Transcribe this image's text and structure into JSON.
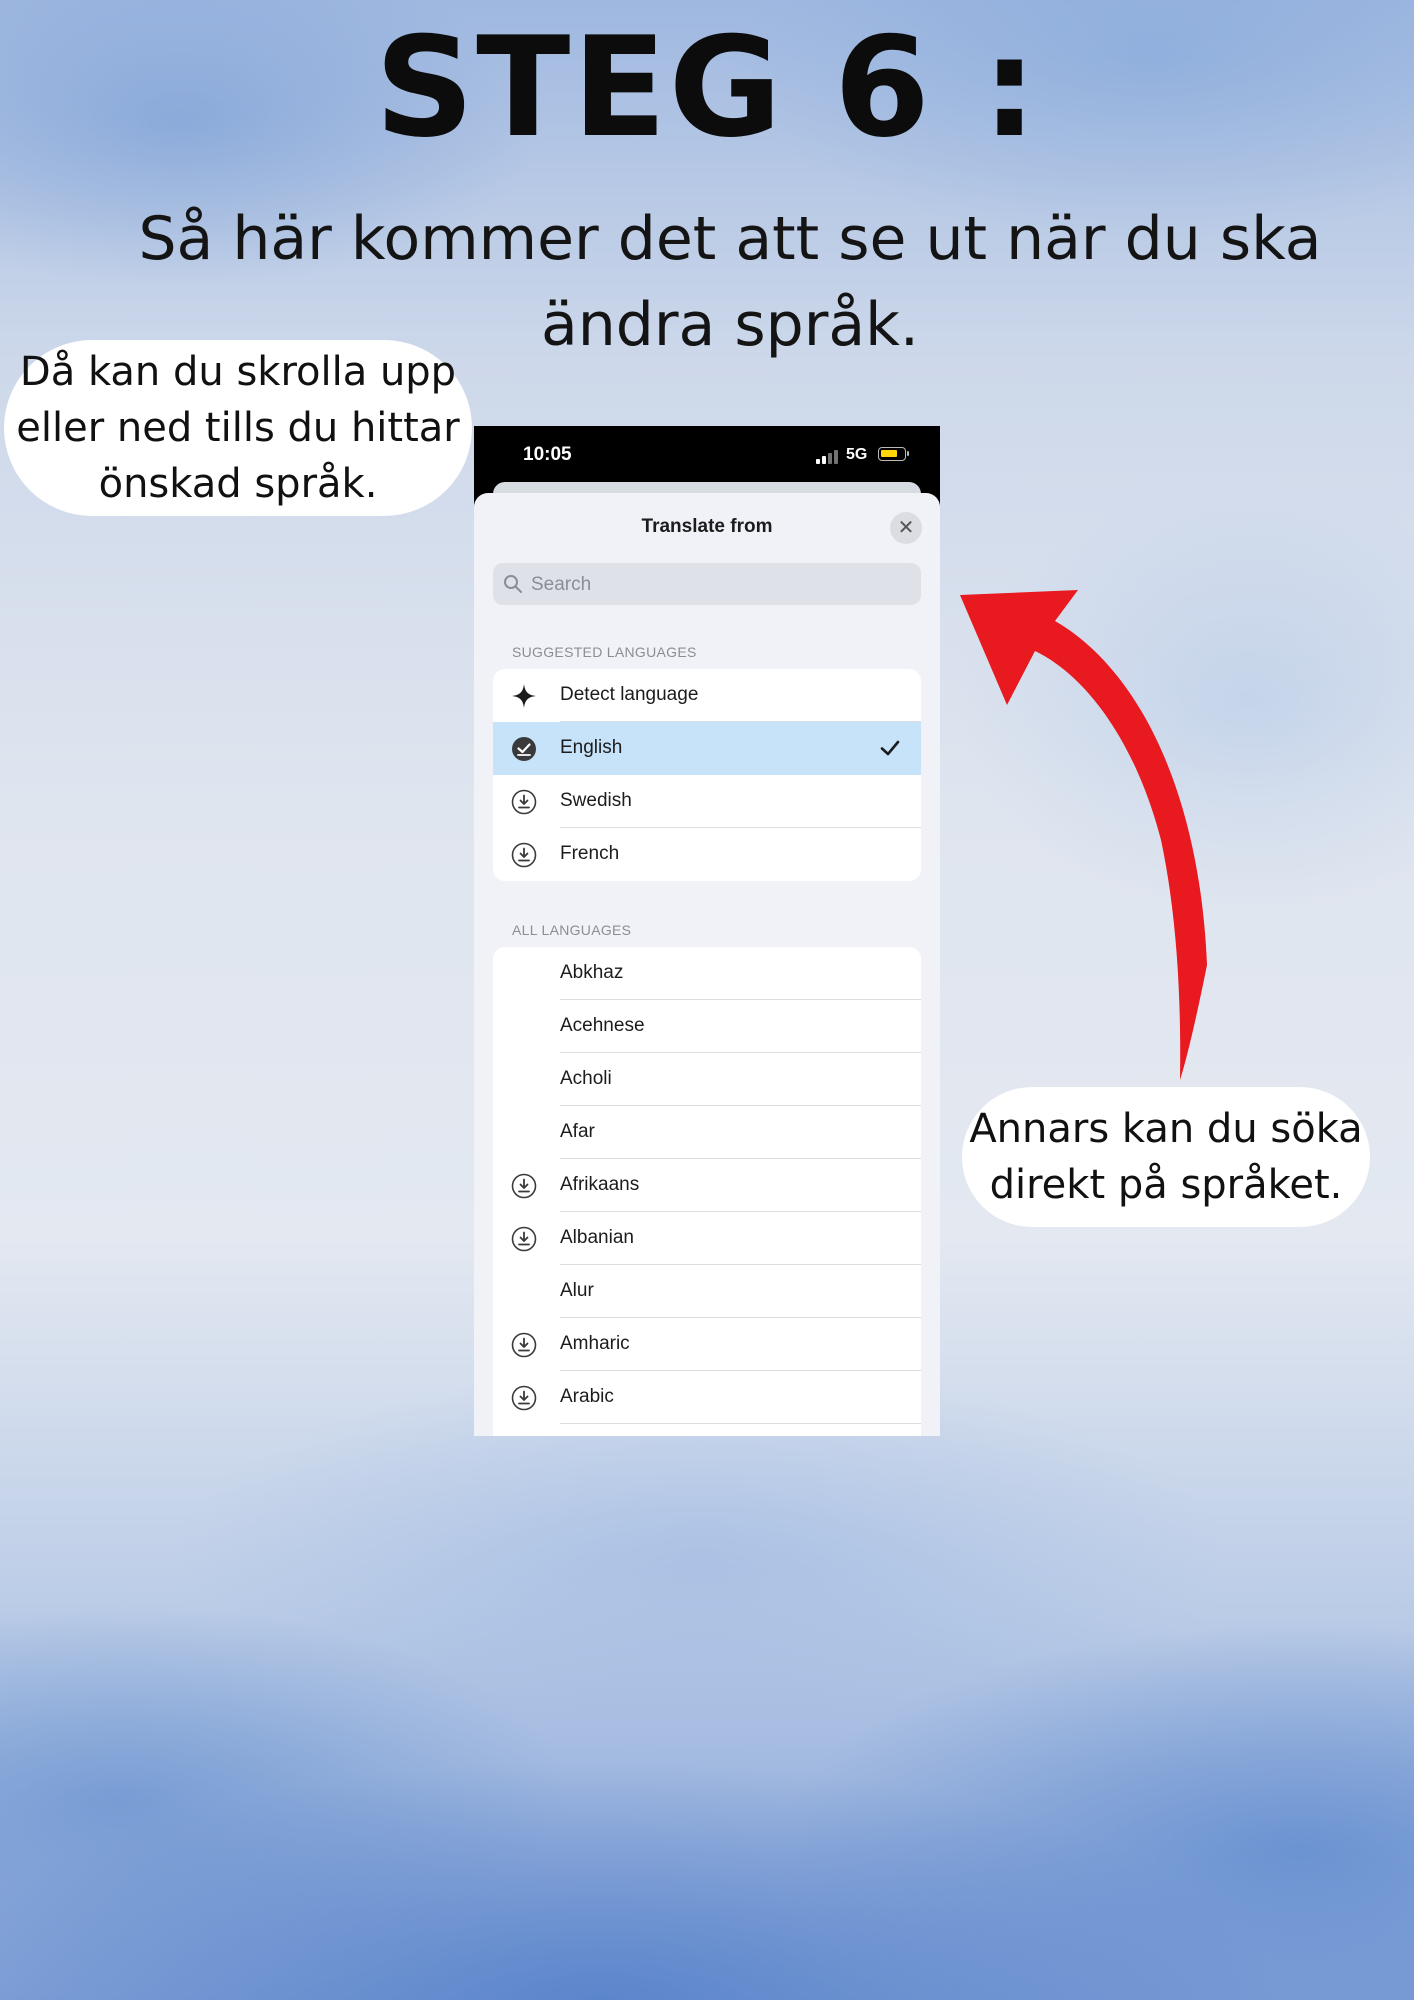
{
  "poster": {
    "title": "STEG 6 :",
    "subtitle": "Så här kommer det att se ut när du ska ändra språk.",
    "bubble_left": [
      "Då kan du skrolla upp",
      "eller ned tills du hittar",
      "önskad språk."
    ],
    "bubble_right": [
      "Annars kan du söka",
      "direkt på språket."
    ],
    "arrow_color": "#e8191f"
  },
  "status_bar": {
    "time": "10:05",
    "network": "5G",
    "battery_color": "#ffd60a"
  },
  "sheet": {
    "title": "Translate from",
    "close_icon": "close-icon",
    "search_placeholder": "Search"
  },
  "suggested": {
    "header": "SUGGESTED LANGUAGES",
    "items": [
      {
        "label": "Detect language",
        "icon": "sparkle-icon",
        "selected": false
      },
      {
        "label": "English",
        "icon": "downloaded-check-icon",
        "selected": true
      },
      {
        "label": "Swedish",
        "icon": "download-icon",
        "selected": false
      },
      {
        "label": "French",
        "icon": "download-icon",
        "selected": false
      }
    ]
  },
  "all": {
    "header": "ALL LANGUAGES",
    "items": [
      {
        "label": "Abkhaz",
        "icon": ""
      },
      {
        "label": "Acehnese",
        "icon": ""
      },
      {
        "label": "Acholi",
        "icon": ""
      },
      {
        "label": "Afar",
        "icon": ""
      },
      {
        "label": "Afrikaans",
        "icon": "download-icon"
      },
      {
        "label": "Albanian",
        "icon": "download-icon"
      },
      {
        "label": "Alur",
        "icon": ""
      },
      {
        "label": "Amharic",
        "icon": "download-icon"
      },
      {
        "label": "Arabic",
        "icon": "download-icon"
      }
    ]
  },
  "colors": {
    "selected_row": "#c6e3f9",
    "sheet_bg": "#f1f2f7"
  }
}
